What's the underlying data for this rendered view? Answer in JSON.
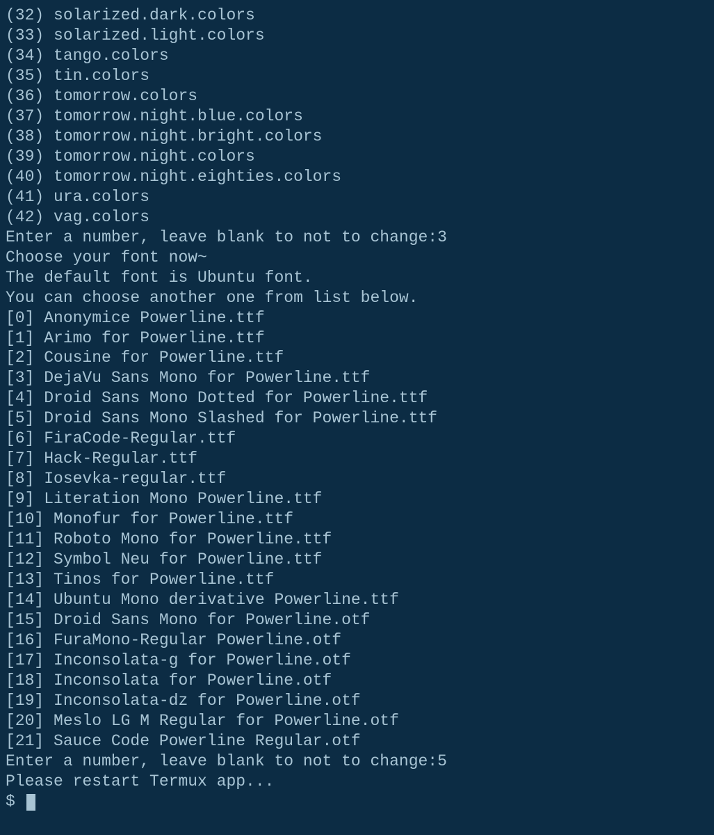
{
  "colorItems": [
    {
      "num": "32",
      "name": "solarized.dark.colors"
    },
    {
      "num": "33",
      "name": "solarized.light.colors"
    },
    {
      "num": "34",
      "name": "tango.colors"
    },
    {
      "num": "35",
      "name": "tin.colors"
    },
    {
      "num": "36",
      "name": "tomorrow.colors"
    },
    {
      "num": "37",
      "name": "tomorrow.night.blue.colors"
    },
    {
      "num": "38",
      "name": "tomorrow.night.bright.colors"
    },
    {
      "num": "39",
      "name": "tomorrow.night.colors"
    },
    {
      "num": "40",
      "name": "tomorrow.night.eighties.colors"
    },
    {
      "num": "41",
      "name": "ura.colors"
    },
    {
      "num": "42",
      "name": "vag.colors"
    }
  ],
  "colorPrompt": {
    "text": "Enter a number, leave blank to not to change:",
    "input": "3"
  },
  "fontHeader": {
    "line1": "Choose your font now~",
    "line2": "The default font is Ubuntu font.",
    "line3": "You can choose another one from list below."
  },
  "fontItems": [
    {
      "num": "0",
      "name": "Anonymice Powerline.ttf"
    },
    {
      "num": "1",
      "name": "Arimo for Powerline.ttf"
    },
    {
      "num": "2",
      "name": "Cousine for Powerline.ttf"
    },
    {
      "num": "3",
      "name": "DejaVu Sans Mono for Powerline.ttf"
    },
    {
      "num": "4",
      "name": "Droid Sans Mono Dotted for Powerline.ttf"
    },
    {
      "num": "5",
      "name": "Droid Sans Mono Slashed for Powerline.ttf"
    },
    {
      "num": "6",
      "name": "FiraCode-Regular.ttf"
    },
    {
      "num": "7",
      "name": "Hack-Regular.ttf"
    },
    {
      "num": "8",
      "name": "Iosevka-regular.ttf"
    },
    {
      "num": "9",
      "name": "Literation Mono Powerline.ttf"
    },
    {
      "num": "10",
      "name": "Monofur for Powerline.ttf"
    },
    {
      "num": "11",
      "name": "Roboto Mono for Powerline.ttf"
    },
    {
      "num": "12",
      "name": "Symbol Neu for Powerline.ttf"
    },
    {
      "num": "13",
      "name": "Tinos for Powerline.ttf"
    },
    {
      "num": "14",
      "name": "Ubuntu Mono derivative Powerline.ttf"
    },
    {
      "num": "15",
      "name": "Droid Sans Mono for Powerline.otf"
    },
    {
      "num": "16",
      "name": "FuraMono-Regular Powerline.otf"
    },
    {
      "num": "17",
      "name": "Inconsolata-g for Powerline.otf"
    },
    {
      "num": "18",
      "name": "Inconsolata for Powerline.otf"
    },
    {
      "num": "19",
      "name": "Inconsolata-dz for Powerline.otf"
    },
    {
      "num": "20",
      "name": "Meslo LG M Regular for Powerline.otf"
    },
    {
      "num": "21",
      "name": "Sauce Code Powerline Regular.otf"
    }
  ],
  "fontPrompt": {
    "text": "Enter a number, leave blank to not to change:",
    "input": "5"
  },
  "restartMessage": "Please restart Termux app...",
  "shellPrompt": "$ "
}
